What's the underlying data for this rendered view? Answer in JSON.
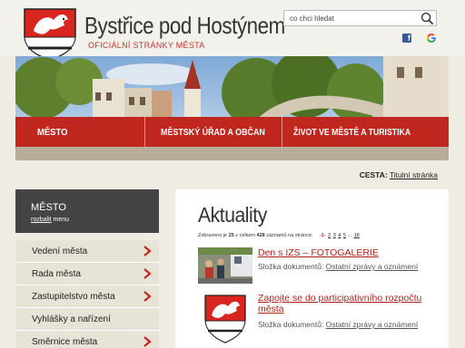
{
  "header": {
    "title": "Bystřice pod Hostýnem",
    "subtitle": "OFICIÁLNÍ STRÁNKY MĚSTA",
    "search_placeholder": "co chci hledat",
    "facebook_glyph": "f"
  },
  "nav": {
    "items": [
      {
        "label": "MĚSTO"
      },
      {
        "label": "MĚSTSKÝ ÚŘAD A OBČAN"
      },
      {
        "label": "ŽIVOT VE MĚSTĚ A TURISTIKA"
      }
    ]
  },
  "breadcrumb": {
    "label": "CESTA:",
    "current": "Titulní stránka"
  },
  "sidebar": {
    "title": "MĚSTO",
    "expand_link": "rozbalit",
    "expand_suffix": "menu",
    "items": [
      {
        "label": "Vedení města"
      },
      {
        "label": "Rada města"
      },
      {
        "label": "Zastupitelstvo města"
      },
      {
        "label": "Vyhlášky a nařízení"
      },
      {
        "label": "Směrnice města"
      }
    ]
  },
  "main": {
    "heading": "Aktuality",
    "summary": {
      "prefix": "Zobrazeno je",
      "shown": "25",
      "middle": "z celkem",
      "total": "428",
      "suffix": "záznamů na stránce:",
      "pages": [
        "-1-",
        "2",
        "3",
        "4",
        "5",
        "...",
        "18"
      ]
    },
    "news": [
      {
        "title": "Den s IZS – FOTOGALERIE",
        "meta_label": "Složka dokumentů:",
        "folder": "Ostatní zprávy a oznámení"
      },
      {
        "title": "Zapojte se do participativního rozpočtu města",
        "meta_label": "Složka dokumentů:",
        "folder": "Ostatní zprávy a oznámení"
      }
    ]
  },
  "colors": {
    "brand_red": "#c0271f",
    "link_red": "#b22119",
    "sidebar_dark": "#444444",
    "sidebar_item": "#e8e3d7",
    "page_bg": "#efece4"
  },
  "icons": [
    "city-crest-icon",
    "search-icon",
    "facebook-icon",
    "google-icon",
    "chevron-right-icon"
  ]
}
